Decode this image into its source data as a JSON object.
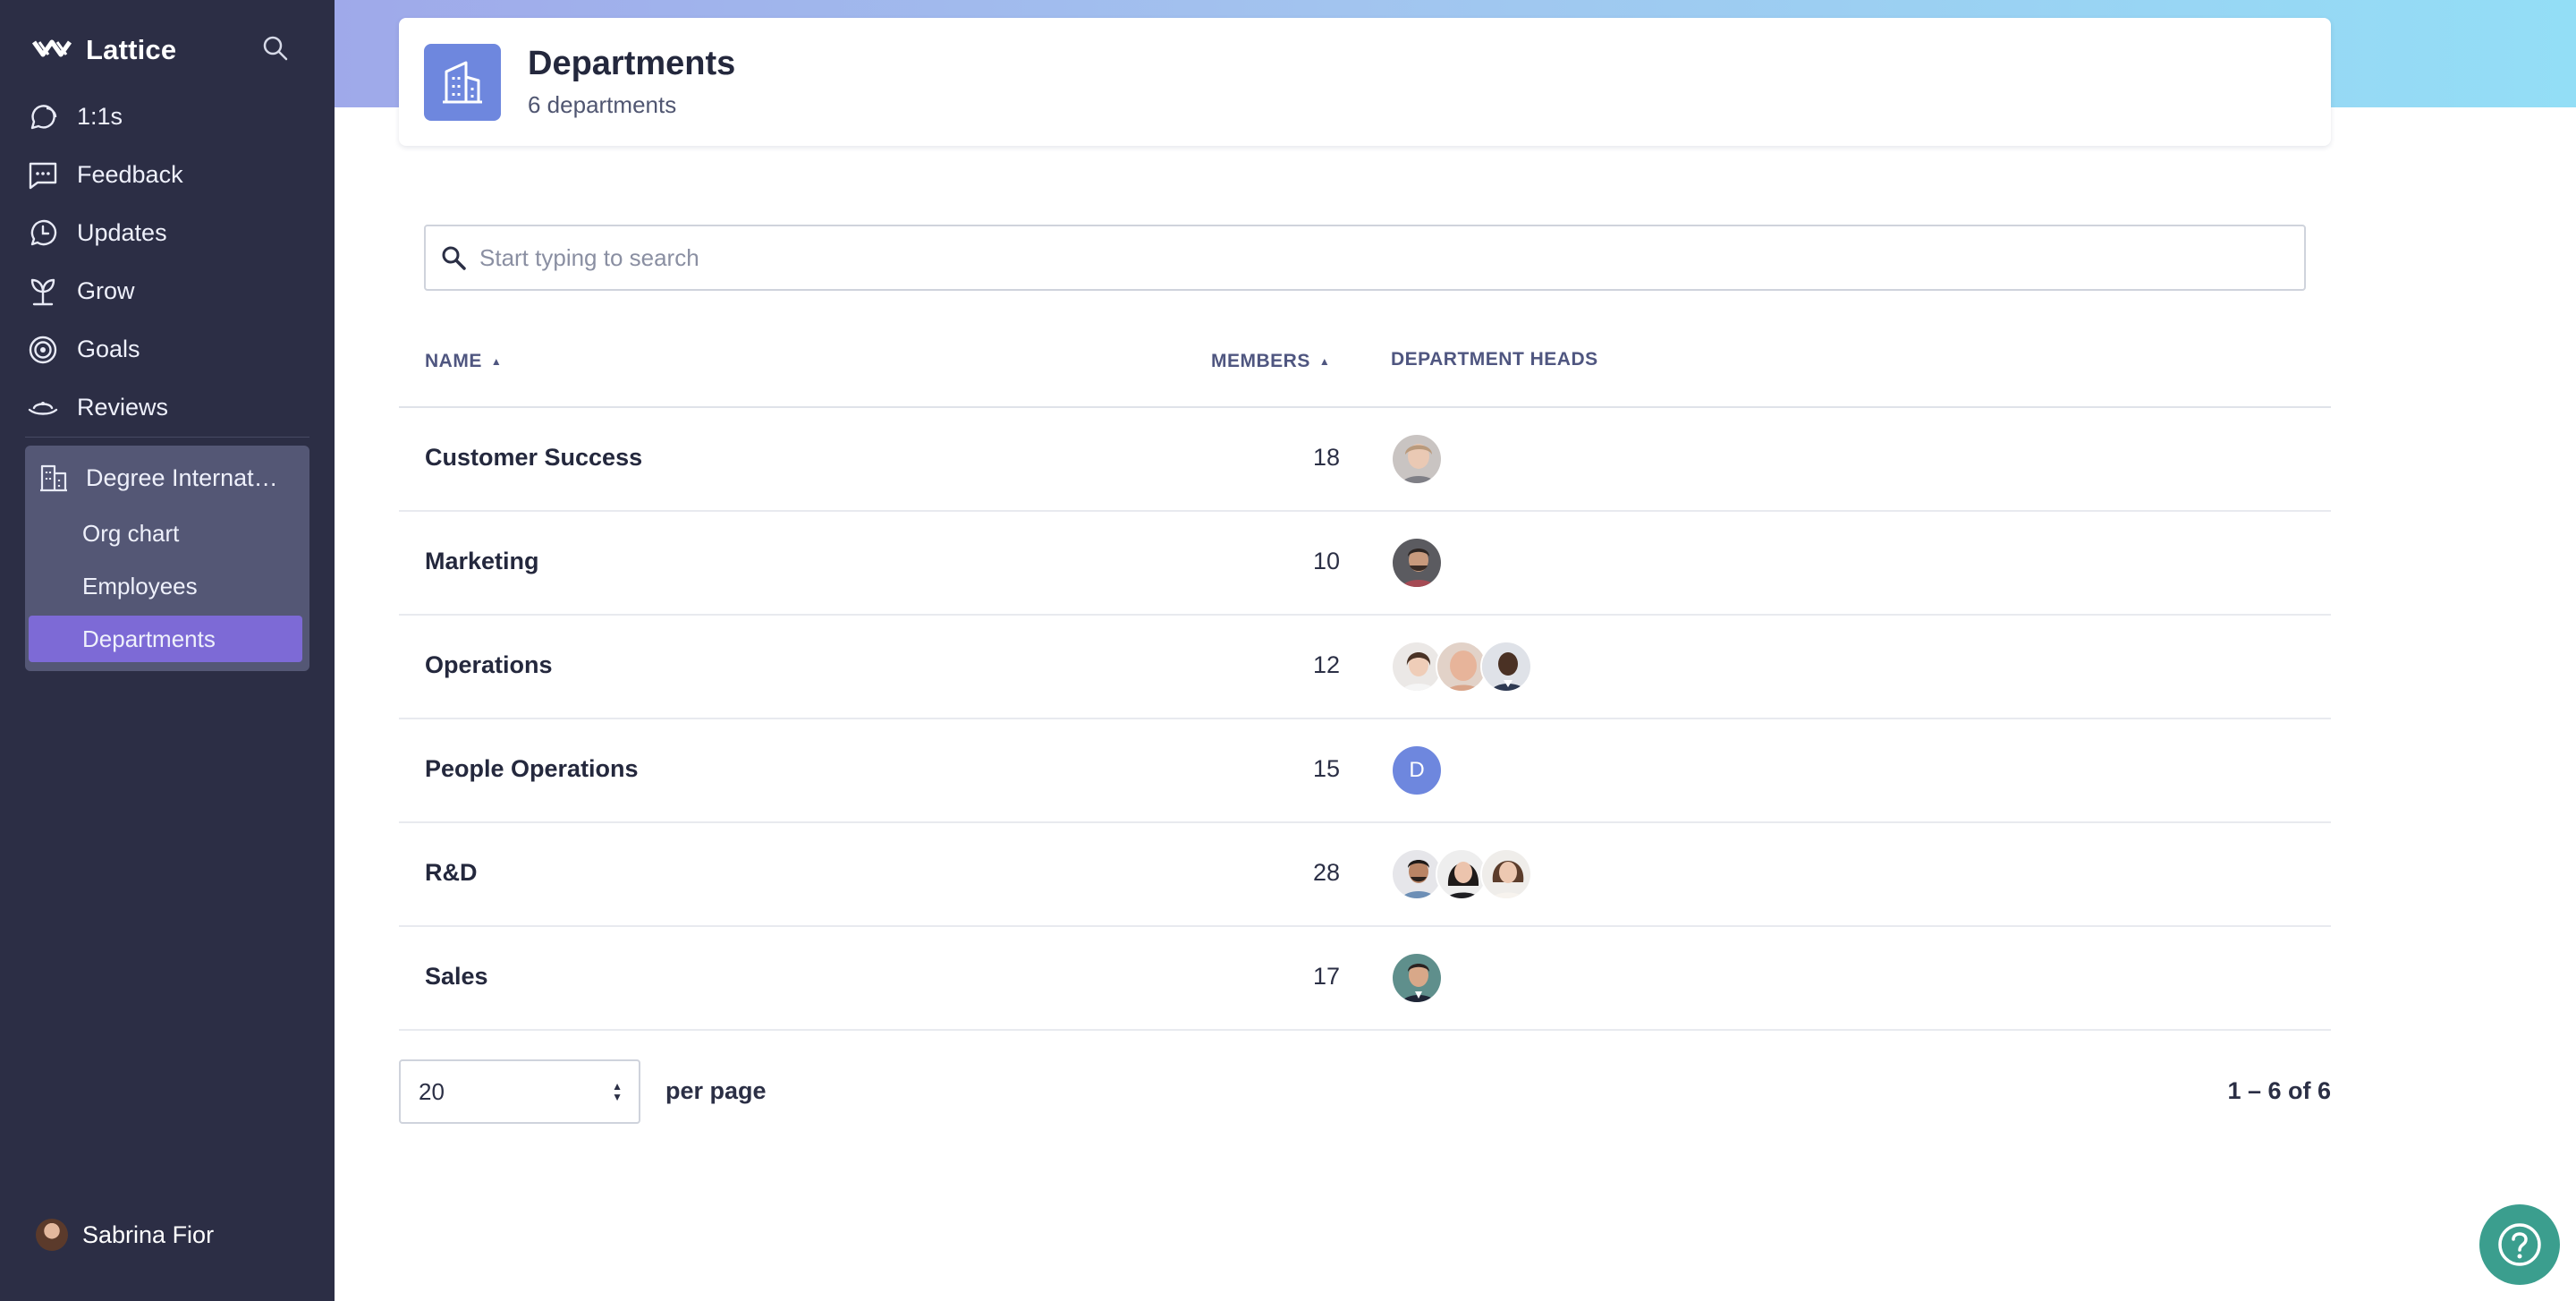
{
  "brand": {
    "name": "Lattice"
  },
  "sidebar": {
    "nav": [
      {
        "label": "1:1s",
        "icon": "chat-bubbles-icon"
      },
      {
        "label": "Feedback",
        "icon": "feedback-icon"
      },
      {
        "label": "Updates",
        "icon": "updates-icon"
      },
      {
        "label": "Grow",
        "icon": "grow-icon"
      },
      {
        "label": "Goals",
        "icon": "target-icon"
      },
      {
        "label": "Reviews",
        "icon": "reviews-icon"
      }
    ],
    "group": {
      "label": "Degree Internati...",
      "icon": "building-icon",
      "items": [
        {
          "label": "Org chart"
        },
        {
          "label": "Employees"
        },
        {
          "label": "Departments",
          "active": true
        }
      ]
    },
    "user": {
      "name": "Sabrina Fior"
    }
  },
  "header": {
    "title": "Departments",
    "subtitle": "6 departments",
    "icon": "building-icon"
  },
  "search": {
    "placeholder": "Start typing to search"
  },
  "table": {
    "columns": {
      "name": "NAME",
      "members": "MEMBERS",
      "heads": "DEPARTMENT HEADS"
    },
    "rows": [
      {
        "name": "Customer Success",
        "members": "18",
        "heads": [
          "photo-woman-1"
        ]
      },
      {
        "name": "Marketing",
        "members": "10",
        "heads": [
          "photo-man-1"
        ]
      },
      {
        "name": "Operations",
        "members": "12",
        "heads": [
          "photo-woman-2",
          "photo-man-2",
          "photo-man-3"
        ]
      },
      {
        "name": "People Operations",
        "members": "15",
        "heads": [
          "D"
        ]
      },
      {
        "name": "R&D",
        "members": "28",
        "heads": [
          "photo-man-4",
          "photo-woman-3",
          "photo-woman-4"
        ]
      },
      {
        "name": "Sales",
        "members": "17",
        "heads": [
          "photo-man-5"
        ]
      }
    ]
  },
  "pagination": {
    "per_page_value": "20",
    "per_page_label": "per page",
    "range": "1 – 6 of 6"
  },
  "colors": {
    "sidebar": "#2c2e45",
    "active": "#7d6ad6",
    "accent": "#6e87de",
    "help": "#3b9e8e"
  }
}
